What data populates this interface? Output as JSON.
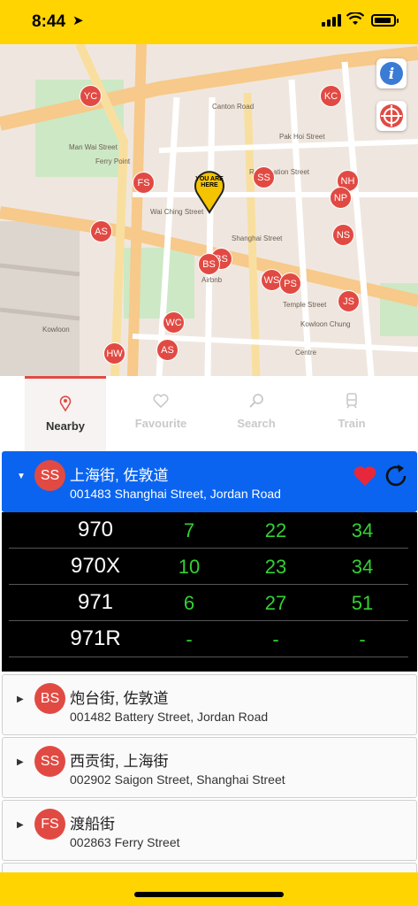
{
  "status_bar": {
    "time": "8:44",
    "location_icon": "location-arrow-icon",
    "signal_icon": "cellular-signal-icon",
    "wifi_icon": "wifi-icon",
    "battery_icon": "battery-icon"
  },
  "map": {
    "you_are_here": "YOU ARE HERE",
    "info_icon": "info-icon",
    "compass_icon": "compass-icon",
    "pins": [
      {
        "code": "YC"
      },
      {
        "code": "KC"
      },
      {
        "code": "FS"
      },
      {
        "code": "SS"
      },
      {
        "code": "NH"
      },
      {
        "code": "NP"
      },
      {
        "code": "AS"
      },
      {
        "code": "NS"
      },
      {
        "code": "BS"
      },
      {
        "code": "BS"
      },
      {
        "code": "WS"
      },
      {
        "code": "PS"
      },
      {
        "code": "JS"
      },
      {
        "code": "WC"
      },
      {
        "code": "AS"
      },
      {
        "code": "HW"
      }
    ],
    "labels": [
      "Man Wai Street",
      "Ferry Point",
      "Wai Ching Street",
      "Canton Road",
      "Pak Hoi Street",
      "Reclamation Street",
      "Shanghai Street",
      "Temple Street",
      "Kowloon",
      "Airbnb",
      "Kowloon Chung",
      "Centre"
    ]
  },
  "tabs": [
    {
      "label": "Nearby",
      "icon": "map-pin-icon",
      "active": true
    },
    {
      "label": "Favourite",
      "icon": "heart-outline-icon",
      "active": false
    },
    {
      "label": "Search",
      "icon": "search-icon",
      "active": false
    },
    {
      "label": "Train",
      "icon": "train-icon",
      "active": false
    }
  ],
  "stops": [
    {
      "badge": "SS",
      "name_zh": "上海街, 佐敦道",
      "detail": "001483 Shanghai Street, Jordan Road",
      "expanded": true,
      "favourite": true
    },
    {
      "badge": "BS",
      "name_zh": "炮台街, 佐敦道",
      "detail": "001482 Battery Street, Jordan Road",
      "expanded": false
    },
    {
      "badge": "SS",
      "name_zh": "西贡街, 上海街",
      "detail": "002902 Saigon Street, Shanghai Street",
      "expanded": false
    },
    {
      "badge": "FS",
      "name_zh": "渡船街",
      "detail": "002863 Ferry Street",
      "expanded": false
    }
  ],
  "eta": [
    {
      "route": "970",
      "t1": "7",
      "t2": "22",
      "t3": "34"
    },
    {
      "route": "970X",
      "t1": "10",
      "t2": "23",
      "t3": "34"
    },
    {
      "route": "971",
      "t1": "6",
      "t2": "27",
      "t3": "51"
    },
    {
      "route": "971R",
      "t1": "-",
      "t2": "-",
      "t3": "-"
    }
  ],
  "colors": {
    "status_bar": "#ffd400",
    "pin": "#e14a43",
    "selected_row": "#0a64f0",
    "eta_text": "#33d133",
    "eta_bg": "#000000"
  }
}
